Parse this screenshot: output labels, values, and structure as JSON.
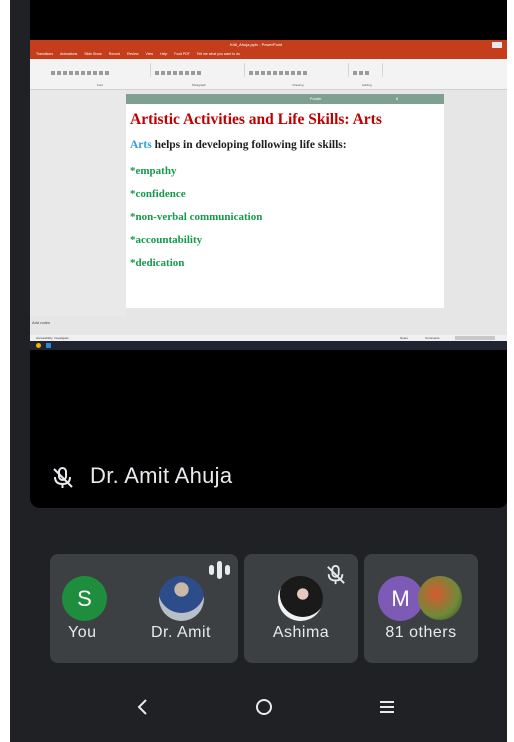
{
  "presentation": {
    "window_title": "Kriti_Ahuja.pptx - PowerPoint",
    "tabs": [
      "Transitions",
      "Animations",
      "Slide Show",
      "Record",
      "Review",
      "View",
      "Help",
      "Foxit PDF"
    ],
    "tell_me": "Tell me what you want to do",
    "ribbon_groups": [
      "Font",
      "Paragraph",
      "Drawing",
      "Editing"
    ],
    "slide_header": "Footer",
    "slide_number": "8",
    "slide_title": "Artistic Activities and  Life Skills: Arts",
    "intro_highlight": "Arts",
    "intro_rest": " helps in developing following life skills:",
    "skills": [
      "*empathy",
      "*confidence",
      "*non-verbal communication",
      "*accountability",
      "*dedication"
    ],
    "notes_text": "Add notes",
    "status_left": "Accessibility: Investigate",
    "status_notes": "Notes",
    "status_comments": "Comments"
  },
  "meeting": {
    "speaker_name": "Dr. Amit Ahuja",
    "participants": [
      {
        "label": "You",
        "initial": "S",
        "color": "#1e8e3e"
      },
      {
        "label": "Dr. Amit"
      },
      {
        "label": "Ashima"
      },
      {
        "label": "81 others",
        "initial": "M",
        "color": "#7c5ab5"
      }
    ]
  },
  "icons": {
    "mic_off": "mic-off-icon",
    "speaking": "speaking-bars-icon",
    "back": "back-nav-icon",
    "home": "home-nav-icon",
    "menu": "menu-nav-icon"
  }
}
